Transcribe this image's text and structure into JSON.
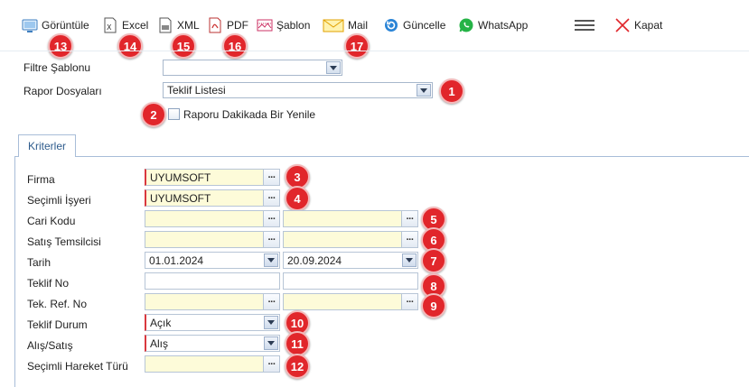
{
  "toolbar": {
    "view_label": "Görüntüle",
    "excel_label": "Excel",
    "xml_label": "XML",
    "pdf_label": "PDF",
    "template_label": "Şablon",
    "mail_label": "Mail",
    "refresh_label": "Güncelle",
    "whatsapp_label": "WhatsApp",
    "close_label": "Kapat"
  },
  "header_form": {
    "filter_template_label": "Filtre Şablonu",
    "filter_template_value": "",
    "report_files_label": "Rapor Dosyaları",
    "report_files_value": "Teklif Listesi",
    "auto_refresh_label": "Raporu Dakikada Bir Yenile"
  },
  "tabs": {
    "criteria": "Kriterler"
  },
  "criteria": {
    "firma": {
      "label": "Firma",
      "value": "UYUMSOFT"
    },
    "isyeri": {
      "label": "Seçimli İşyeri",
      "value": "UYUMSOFT"
    },
    "cari_kodu": {
      "label": "Cari Kodu",
      "from": "",
      "to": ""
    },
    "satis_temsilcisi": {
      "label": "Satış Temsilcisi",
      "from": "",
      "to": ""
    },
    "tarih": {
      "label": "Tarih",
      "from": "01.01.2024",
      "to": "20.09.2024"
    },
    "teklif_no": {
      "label": "Teklif No",
      "from": "",
      "to": ""
    },
    "tek_ref_no": {
      "label": "Tek. Ref. No",
      "from": "",
      "to": ""
    },
    "teklif_durum": {
      "label": "Teklif Durum",
      "value": "Açık"
    },
    "alis_satis": {
      "label": "Alış/Satış",
      "value": "Alış"
    },
    "hareket_turu": {
      "label": "Seçimli Hareket Türü",
      "value": ""
    }
  },
  "badges": [
    "1",
    "2",
    "3",
    "4",
    "5",
    "6",
    "7",
    "8",
    "9",
    "10",
    "11",
    "12",
    "13",
    "14",
    "15",
    "16",
    "17"
  ],
  "colors": {
    "badge": "#e1262b",
    "required": "#d9383e",
    "lookup_bg": "#fdfbd9",
    "accent": "#2d5b8c"
  }
}
